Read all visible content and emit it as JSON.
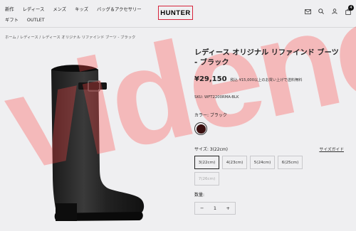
{
  "header": {
    "nav_row1": [
      "新作",
      "レディース",
      "メンズ",
      "キッズ",
      "バッグ＆アクセサリー"
    ],
    "nav_row2": [
      "ギフト",
      "OUTLET"
    ],
    "logo": "HUNTER",
    "cart_count": "4"
  },
  "breadcrumb": "ホーム / レディース / レディース オリジナル リファインド ブーツ - ブラック",
  "watermark": "videnc",
  "product": {
    "title": "レディース オリジナル リファインド ブーツ - ブラック",
    "price": "¥29,150",
    "tax_note": "税込 ¥15,000以上のお買い上げで送料無料",
    "sku": "SKU: WFT2200RMA-BLK",
    "color_label": "カラー: ブラック",
    "color_swatch": "#3a1010",
    "size_label": "サイズ: 3(22cm)",
    "size_guide": "サイズガイド",
    "sizes": [
      "3(22cm)",
      "4(23cm)",
      "5(24cm)",
      "6(25cm)",
      "7(26cm)"
    ],
    "quantity_label": "数量:",
    "quantity_value": "1",
    "qty_minus": "−",
    "qty_plus": "+"
  },
  "colors": {
    "logo_border": "#d7243b",
    "watermark": "#ff4646"
  }
}
